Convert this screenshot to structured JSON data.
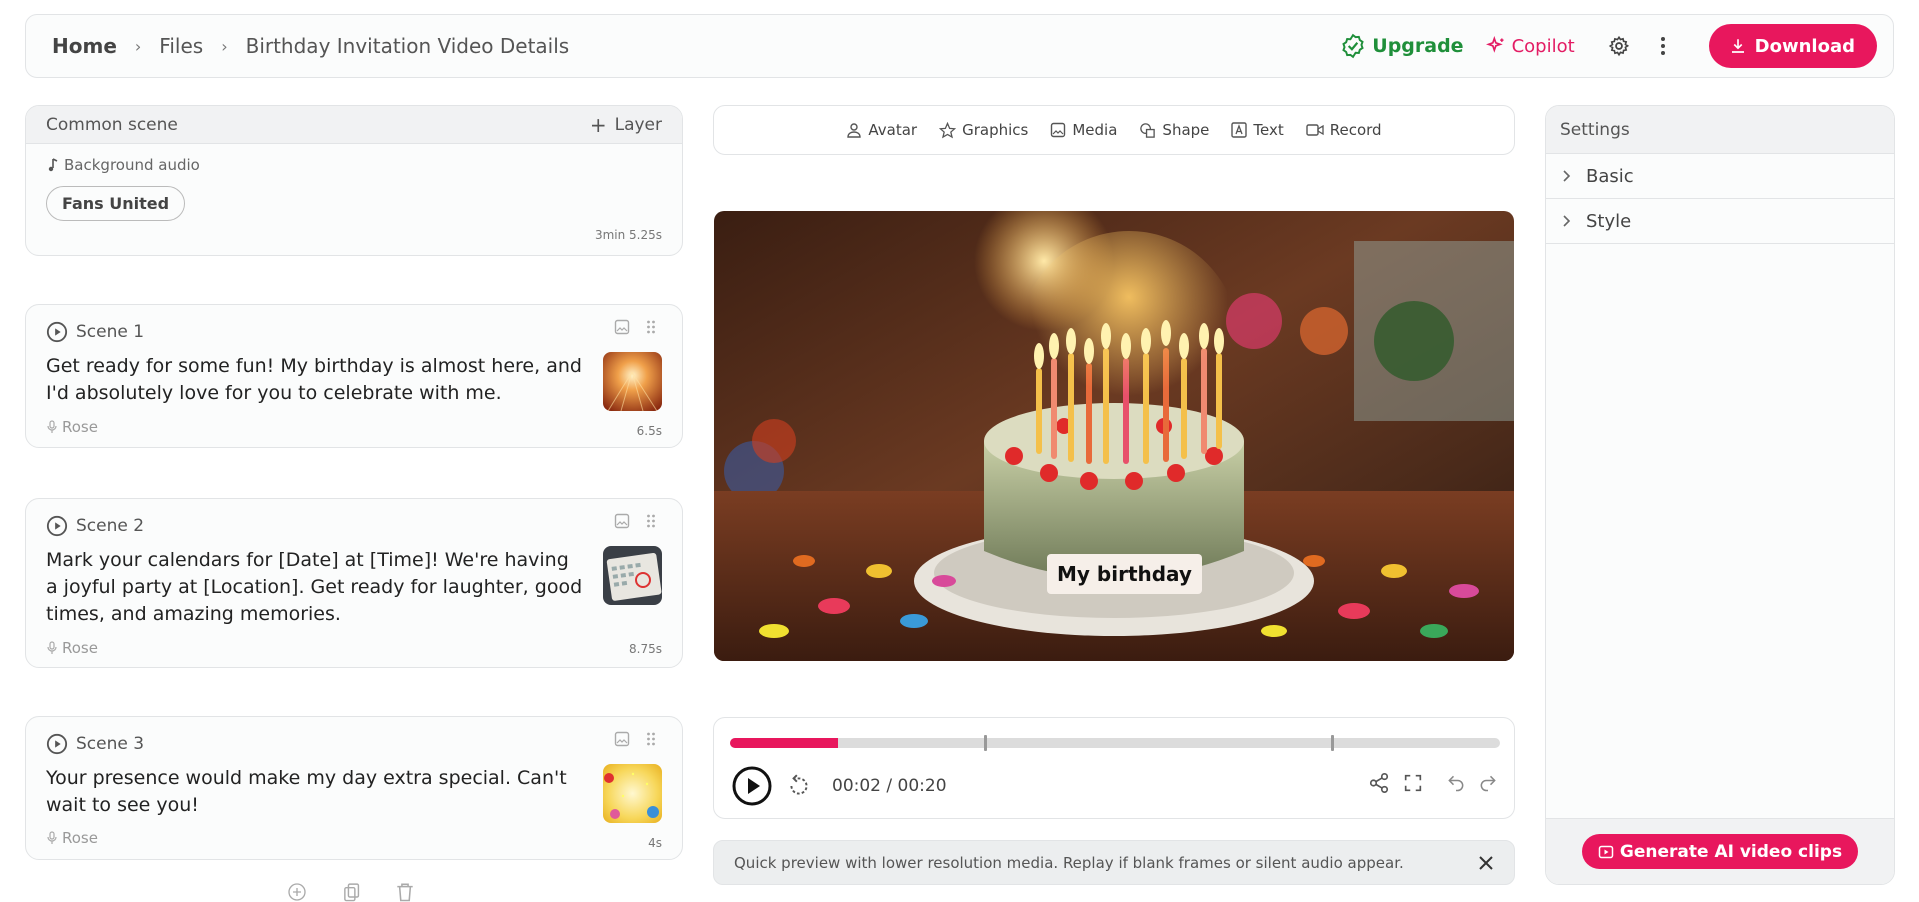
{
  "breadcrumb": {
    "home": "Home",
    "files": "Files",
    "current": "Birthday Invitation Video Details"
  },
  "header": {
    "upgrade_label": "Upgrade",
    "copilot_label": "Copilot",
    "download_label": "Download"
  },
  "colors": {
    "accent": "#e8175d",
    "upgrade_green": "#1f8f3a"
  },
  "common_scene": {
    "title": "Common scene",
    "layer_label": "Layer",
    "background_audio_label": "Background audio",
    "track_name": "Fans United",
    "duration": "3min 5.25s"
  },
  "scenes": [
    {
      "title": "Scene 1",
      "text": "Get ready for some fun! My birthday is almost here, and I'd absolutely love for you to celebrate with me.",
      "voice": "Rose",
      "duration": "6.5s"
    },
    {
      "title": "Scene 2",
      "text": "Mark your calendars for [Date] at [Time]! We're having a joyful party at [Location]. Get ready for laughter, good times, and amazing memories.",
      "voice": "Rose",
      "duration": "8.75s"
    },
    {
      "title": "Scene 3",
      "text": "Your presence would make my day extra special. Can't wait to see you!",
      "voice": "Rose",
      "duration": "4s"
    }
  ],
  "toolbar": {
    "avatar": "Avatar",
    "graphics": "Graphics",
    "media": "Media",
    "shape": "Shape",
    "text": "Text",
    "record": "Record"
  },
  "preview": {
    "caption": "My birthday"
  },
  "player": {
    "time": "00:02 / 00:20",
    "progress": 0.14,
    "markers": [
      0.33,
      0.78
    ]
  },
  "notice": {
    "text": "Quick preview with lower resolution media. Replay if blank frames or silent audio appear."
  },
  "settings": {
    "title": "Settings",
    "sections": [
      "Basic",
      "Style"
    ],
    "generate_label": "Generate AI video clips"
  }
}
